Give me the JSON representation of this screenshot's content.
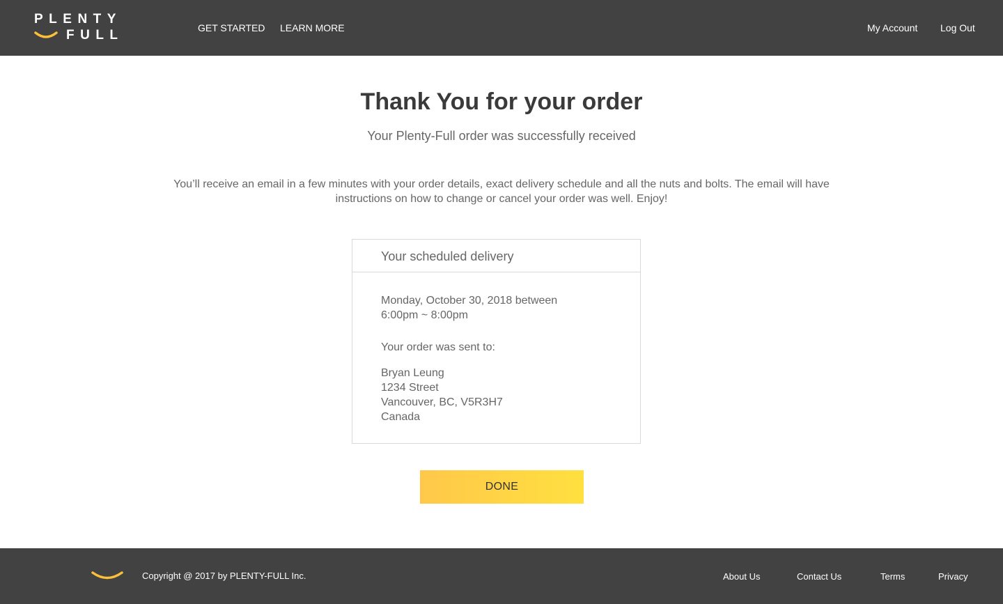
{
  "brand": {
    "logo_top": "PLENTY",
    "logo_bottom": "FULL",
    "accent_color": "#fbbf3a"
  },
  "header": {
    "nav_left": [
      "GET STARTED",
      "LEARN MORE"
    ],
    "account_label": "My Account",
    "logout_label": "Log Out"
  },
  "main": {
    "title": "Thank You for your order",
    "subtitle": "Your Plenty-Full order was successfully received",
    "message": "You’ll receive an email in a few minutes with your order details, exact delivery schedule and all the nuts and bolts. The email will have instructions on how to change or cancel your order was well. Enjoy!"
  },
  "delivery_card": {
    "title": "Your scheduled delivery",
    "date_line": "Monday, October 30, 2018 between",
    "time_line": "6:00pm ~ 8:00pm",
    "sent_to_label": "Your order was sent to:",
    "address_lines": [
      "Bryan Leung",
      "1234 Street",
      "Vancouver, BC, V5R3H7",
      "Canada"
    ]
  },
  "done_button": {
    "label": "DONE",
    "gradient_start": "#ffc84a",
    "gradient_end": "#ffe040"
  },
  "footer": {
    "copyright": "Copyright @ 2017 by PLENTY-FULL Inc.",
    "links": [
      "About Us",
      "Contact Us",
      "Terms",
      "Privacy"
    ]
  }
}
